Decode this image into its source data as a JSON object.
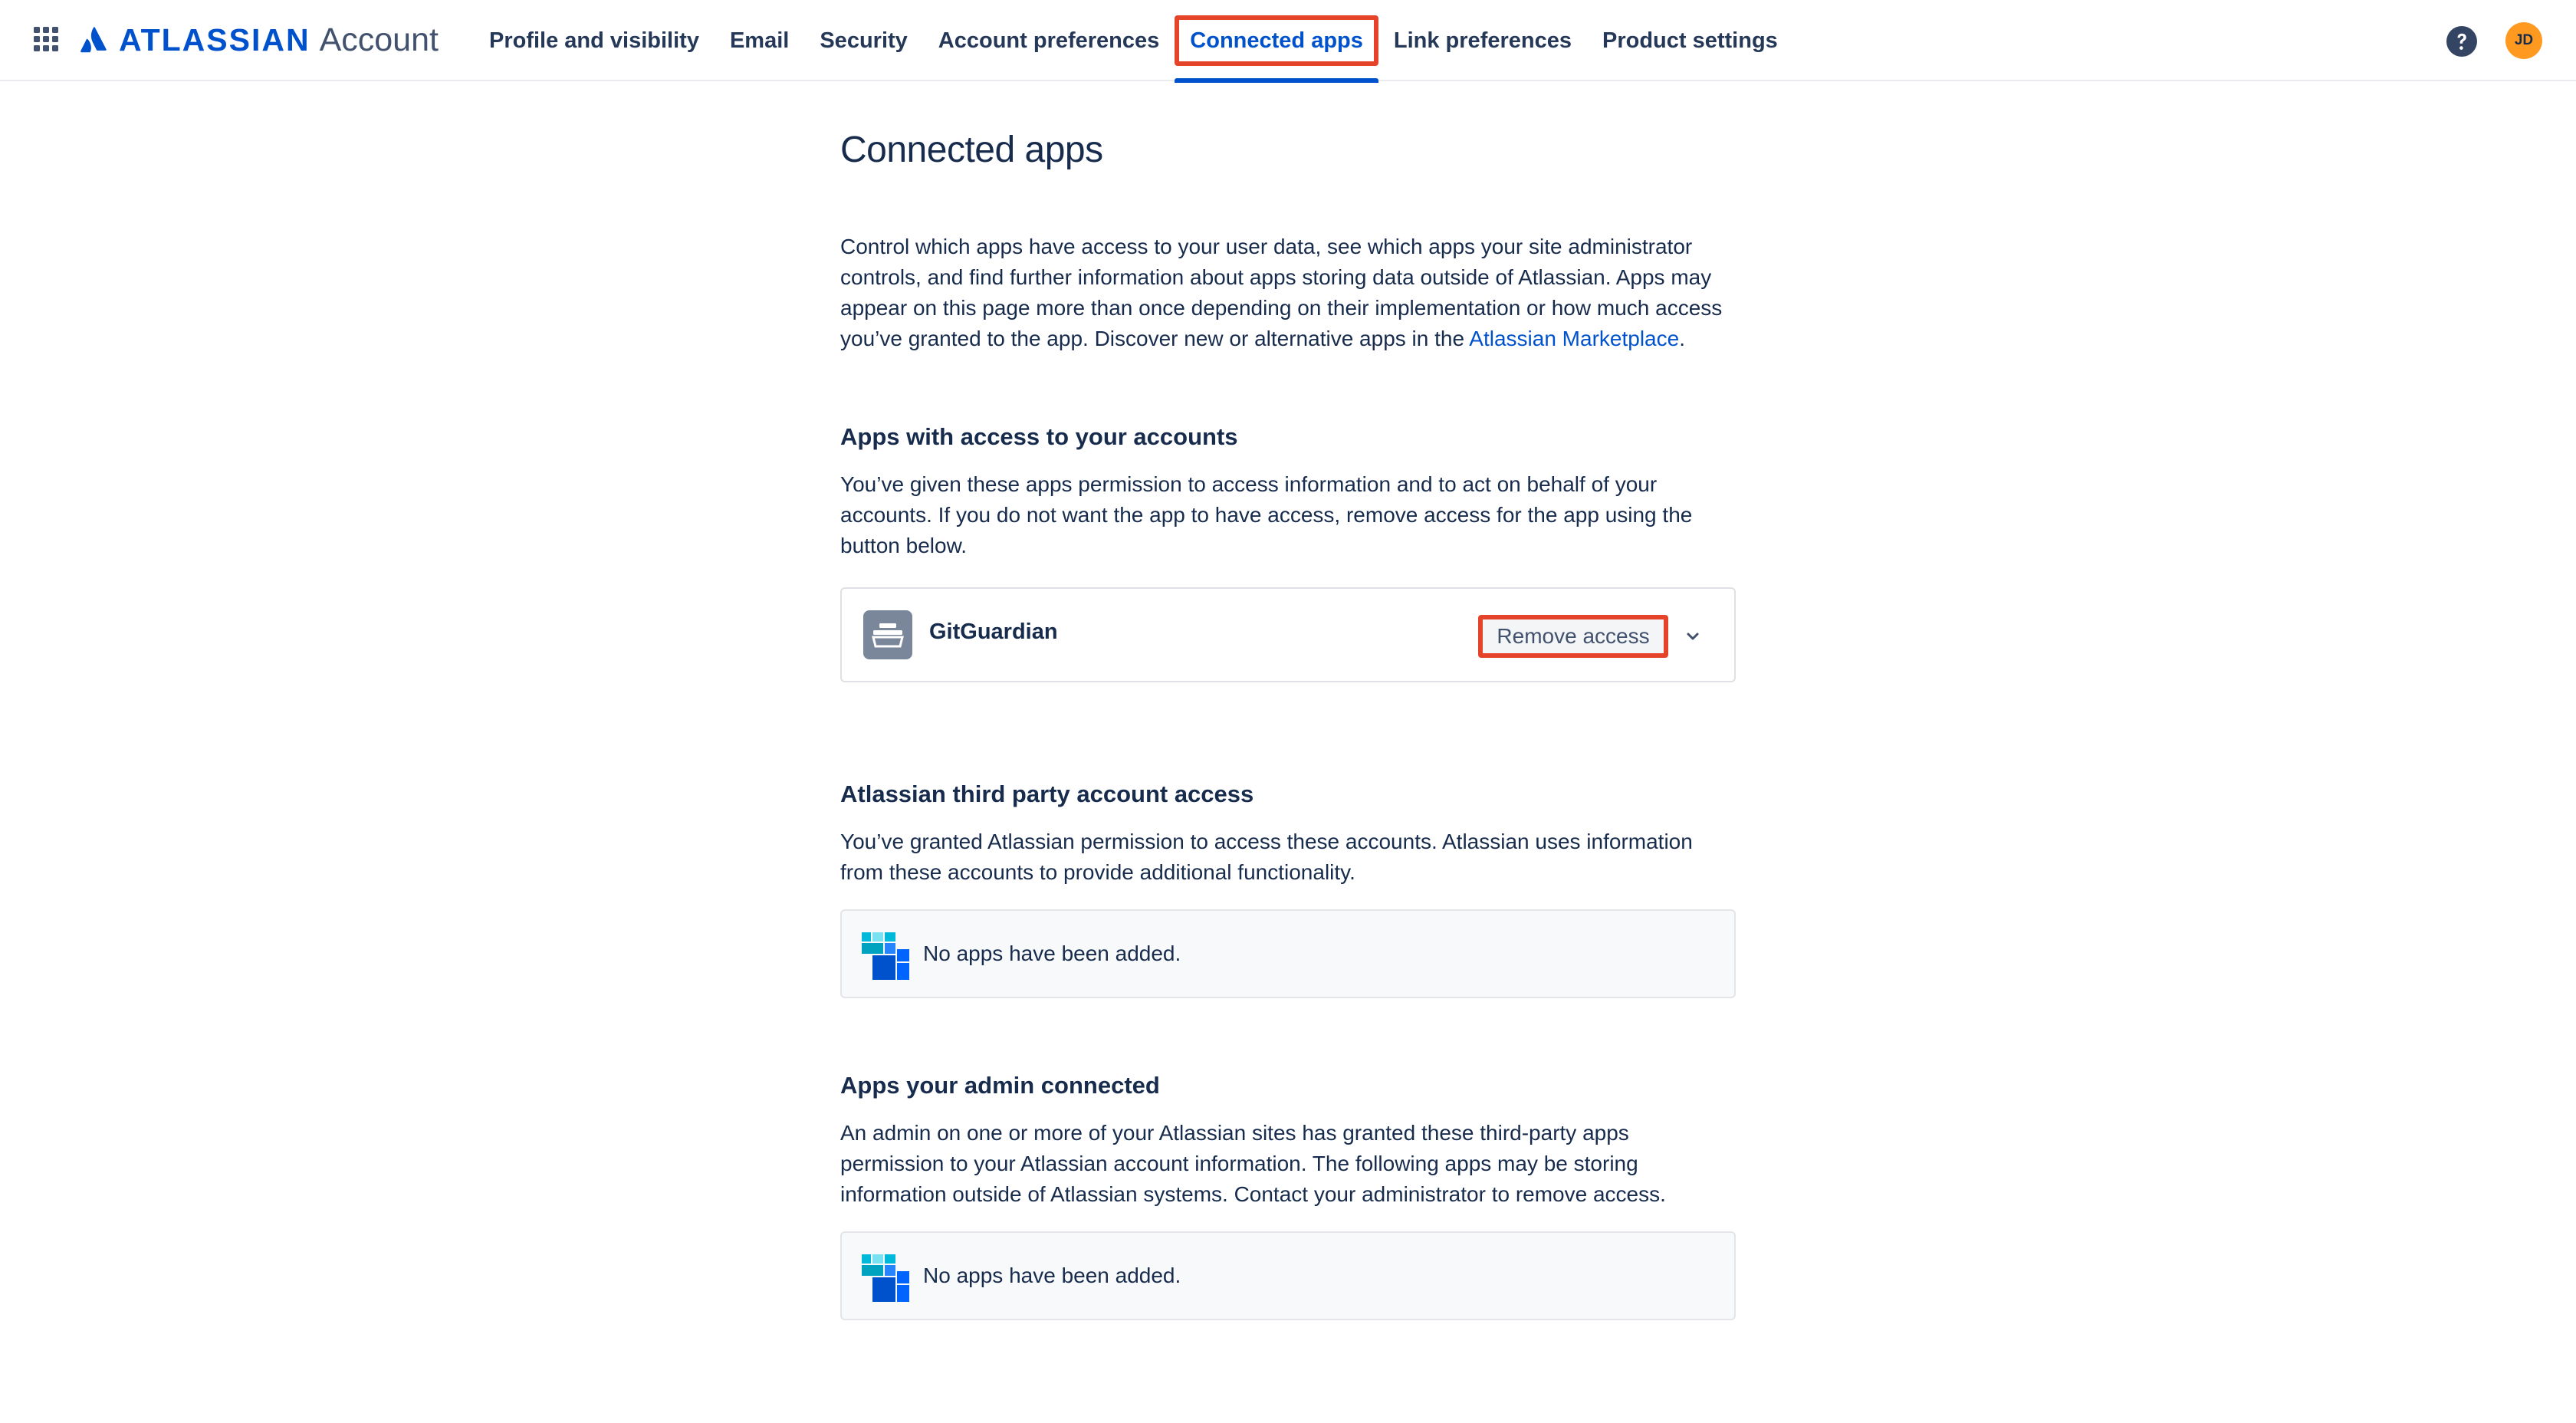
{
  "header": {
    "brand": "ATLASSIAN",
    "product": "Account",
    "avatar_initials": "JD",
    "nav": [
      {
        "label": "Profile and visibility"
      },
      {
        "label": "Email"
      },
      {
        "label": "Security"
      },
      {
        "label": "Account preferences"
      },
      {
        "label": "Connected apps",
        "active": true
      },
      {
        "label": "Link preferences"
      },
      {
        "label": "Product settings"
      }
    ]
  },
  "main": {
    "title": "Connected apps",
    "intro": {
      "text": "Control which apps have access to your user data, see which apps your site administrator controls, and find further information about apps storing data outside of Atlassian. Apps may appear on this page more than once depending on their implementation or how much access you’ve granted to the app. Discover new or alternative apps in the ",
      "link": "Atlassian Marketplace",
      "end": "."
    },
    "apps_access": {
      "heading": "Apps with access to your accounts",
      "description": "You’ve given these apps permission to access information and to act on behalf of your accounts. If you do not want the app to have access, remove access for the app using the button below.",
      "apps": [
        {
          "name": "GitGuardian",
          "action": "Remove access"
        }
      ]
    },
    "third_party": {
      "heading": "Atlassian third party account access",
      "description": "You’ve granted Atlassian permission to access these accounts. Atlassian uses information from these accounts to provide additional functionality.",
      "empty": "No apps have been added."
    },
    "admin_connected": {
      "heading": "Apps your admin connected",
      "description": "An admin on one or more of your Atlassian sites has granted these third-party apps permission to your Atlassian account information. The following apps may be storing information outside of Atlassian systems. Contact your administrator to remove access.",
      "empty": "No apps have been added."
    }
  },
  "colors": {
    "brand_blue": "#0052cc",
    "text": "#172b4d",
    "highlight_red": "#e5442b",
    "avatar": "#ff991f"
  },
  "icons": [
    "app-switcher-icon",
    "atlassian-logo-icon",
    "help-icon",
    "gitguardian-icon",
    "chevron-down-icon",
    "blocks-icon"
  ]
}
